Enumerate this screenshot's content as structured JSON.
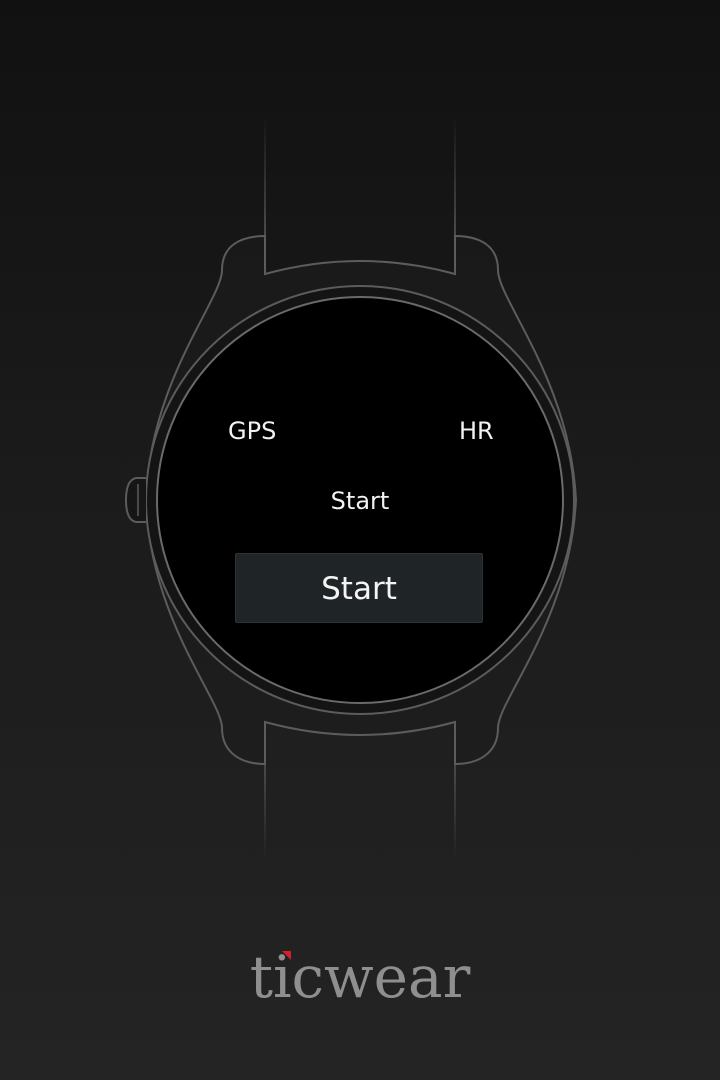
{
  "watch": {
    "gps_label": "GPS",
    "hr_label": "HR",
    "status_text": "Start",
    "start_button_label": "Start"
  },
  "brand": {
    "name": "ticwear",
    "accent_color": "#d51f2a"
  },
  "colors": {
    "background_top": "#111111",
    "background_bottom": "#242424",
    "outline": "#5c5c5c",
    "screen": "#000000",
    "button": "#1f2427",
    "text": "#f2f2f2",
    "brand_text": "#8f8f8f"
  }
}
